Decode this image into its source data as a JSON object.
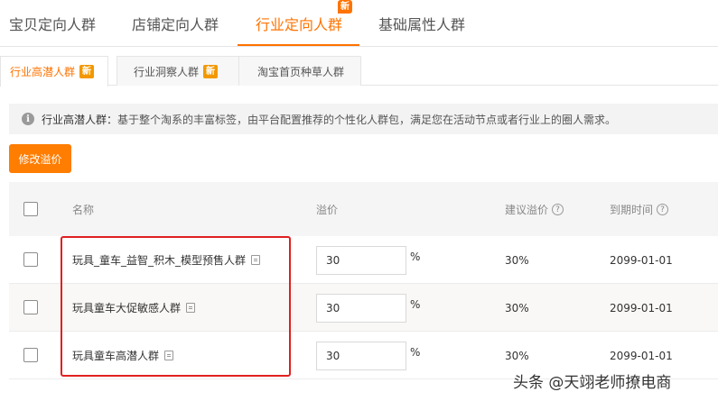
{
  "main_tabs": [
    {
      "label": "宝贝定向人群"
    },
    {
      "label": "店铺定向人群"
    },
    {
      "label": "行业定向人群",
      "badge": "新"
    },
    {
      "label": "基础属性人群"
    }
  ],
  "sub_tabs": [
    {
      "label": "行业高潜人群",
      "badge": "新"
    },
    {
      "label": "行业洞察人群",
      "badge": "新"
    },
    {
      "label": "淘宝首页种草人群"
    }
  ],
  "info": {
    "icon": "i",
    "title": "行业高潜人群：",
    "text": "基于整个淘系的丰富标签，由平台配置推荐的个性化人群包，满足您在活动节点或者行业上的圈人需求。"
  },
  "actions": {
    "edit_label": "修改溢价"
  },
  "table": {
    "headers": {
      "name": "名称",
      "premium": "溢价",
      "suggested": "建议溢价",
      "expire": "到期时间",
      "help": "?"
    },
    "rows": [
      {
        "name": "玩具_童车_益智_积木_模型预售人群",
        "premium": "30",
        "unit": "%",
        "suggested": "30%",
        "expire": "2099-01-01"
      },
      {
        "name": "玩具童车大促敏感人群",
        "premium": "30",
        "unit": "%",
        "suggested": "30%",
        "expire": "2099-01-01"
      },
      {
        "name": "玩具童车高潜人群",
        "premium": "30",
        "unit": "%",
        "suggested": "30%",
        "expire": "2099-01-01"
      }
    ]
  },
  "watermark": "头条 @天翊老师撩电商",
  "colors": {
    "accent": "#ff7300",
    "highlight_box": "#e02020"
  }
}
